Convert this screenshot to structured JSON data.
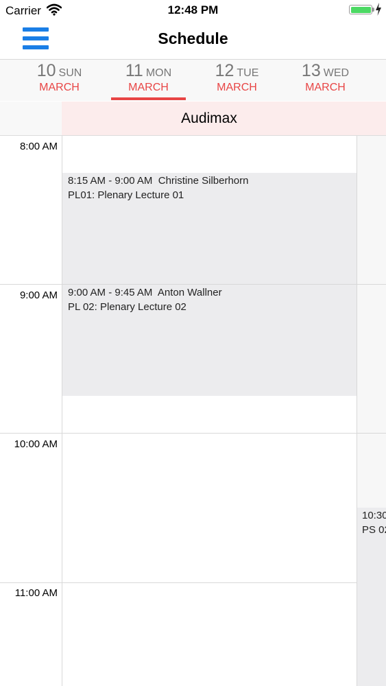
{
  "status_bar": {
    "carrier": "Carrier",
    "time": "12:48 PM",
    "battery_color": "#4cd964",
    "charge_color": "#222222"
  },
  "nav": {
    "title": "Schedule",
    "menu_icon": "hamburger-menu-icon",
    "accent": "#1a7ee6"
  },
  "day_tabs": [
    {
      "day": "10",
      "weekday": "SUN",
      "month": "MARCH",
      "selected": false
    },
    {
      "day": "11",
      "weekday": "MON",
      "month": "MARCH",
      "selected": true
    },
    {
      "day": "12",
      "weekday": "TUE",
      "month": "MARCH",
      "selected": false
    },
    {
      "day": "13",
      "weekday": "WED",
      "month": "MARCH",
      "selected": false
    }
  ],
  "tab_accent": "#e84545",
  "room": {
    "name": "Audimax"
  },
  "hours": [
    "8:00 AM",
    "9:00 AM",
    "10:00 AM",
    "11:00 AM"
  ],
  "events": [
    {
      "time": "8:15 AM - 9:00 AM",
      "speaker": "Christine Silberhorn",
      "title": "PL01: Plenary Lecture 01"
    },
    {
      "time": "9:00 AM - 9:45 AM",
      "speaker": "Anton Wallner",
      "title": "PL 02: Plenary Lecture 02"
    }
  ],
  "next_column_event": {
    "time": "10:30",
    "title": "PS 02"
  }
}
